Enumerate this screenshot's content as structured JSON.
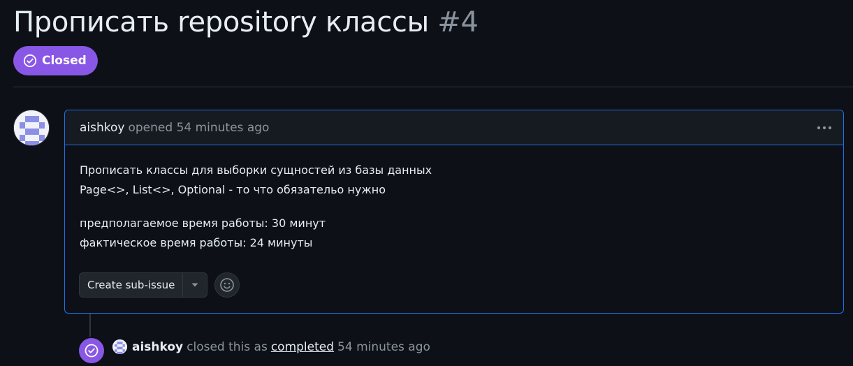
{
  "issue": {
    "title": "Прописать repository классы",
    "number": "#4",
    "state_label": "Closed",
    "state_color": "#8957e5"
  },
  "comment": {
    "author": "aishkoy",
    "opened_text": "opened 54 minutes ago",
    "body": {
      "line1": "Прописать классы для выборки сущностей из базы данных",
      "line2": "Page<>, List<>, Optional - то что обязательо нужно",
      "line3": "предполагаемое время работы: 30 минут",
      "line4": "фактическое время работы: 24 минуты"
    },
    "create_subissue_label": "Create sub-issue",
    "icons": {
      "menu": "kebab-horizontal-icon",
      "dropdown": "triangle-down-icon",
      "emoji": "smiley-icon"
    }
  },
  "timeline": {
    "event_author": "aishkoy",
    "event_pre": "closed this as",
    "event_link": "completed",
    "event_time": "54 minutes ago",
    "event_icon": "check-circle-icon"
  },
  "colors": {
    "background": "#0d1117",
    "accent_blue": "#1f6feb",
    "closed_purple": "#8957e5",
    "muted_text": "#8b949e"
  }
}
